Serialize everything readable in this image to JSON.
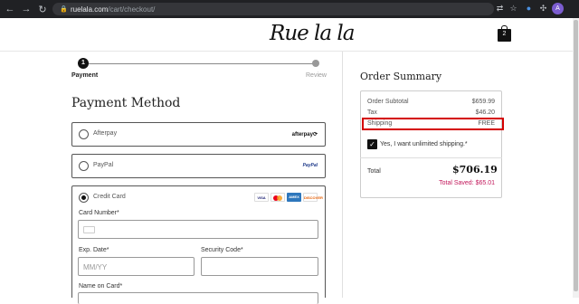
{
  "browser": {
    "url_host": "ruelala.com",
    "url_path": "/cart/checkout/",
    "profile_initial": "A"
  },
  "header": {
    "logo_text": "Rue la la",
    "cart_count": "2"
  },
  "steps": [
    {
      "number": "1",
      "label": "Payment"
    },
    {
      "label": "Review"
    }
  ],
  "payment": {
    "title": "Payment Method",
    "options": [
      {
        "label": "Afterpay",
        "logo": "afterpay⟳"
      },
      {
        "label": "PayPal",
        "logo": "PayPal"
      },
      {
        "label": "Credit Card"
      }
    ],
    "card_brands": [
      "VISA",
      "MC",
      "AMEX",
      "DISCOVER"
    ],
    "fields": {
      "card_number_label": "Card Number*",
      "exp_label": "Exp. Date*",
      "exp_placeholder": "MM/YY",
      "security_label": "Security Code*",
      "name_label": "Name on Card*"
    }
  },
  "summary": {
    "title": "Order Summary",
    "rows": [
      {
        "label": "Order Subtotal",
        "value": "$659.99"
      },
      {
        "label": "Tax",
        "value": "$46.20"
      },
      {
        "label": "Shipping",
        "value": "FREE"
      }
    ],
    "unlimited_label": "Yes, I want unlimited shipping.*",
    "total_label": "Total",
    "total_value": "$706.19",
    "saved_text": "Total Saved: $65.01",
    "colors": {
      "saved": "#c2185b",
      "highlight": "#d40000"
    }
  }
}
